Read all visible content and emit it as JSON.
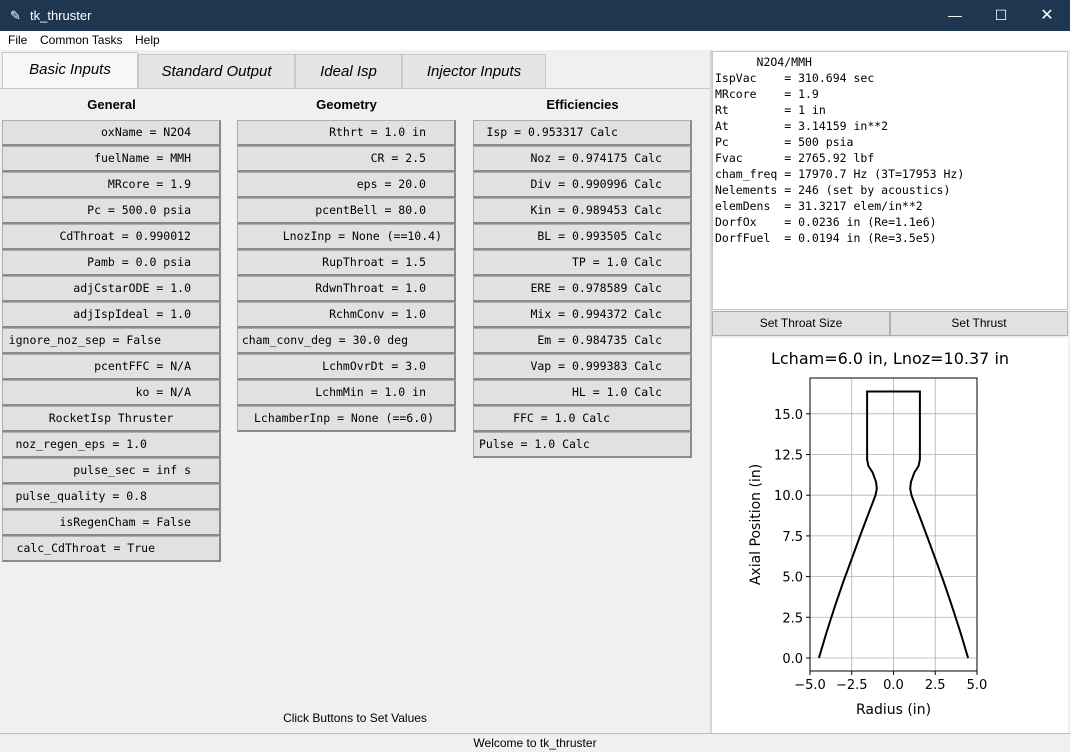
{
  "window": {
    "title": "tk_thruster",
    "min": "—",
    "max": "☐",
    "close": "✕",
    "icon": "feather-icon"
  },
  "menu": [
    "File",
    "Common Tasks",
    "Help"
  ],
  "tabs": [
    "Basic Inputs",
    "Standard Output",
    "Ideal Isp",
    "Injector Inputs"
  ],
  "columns": {
    "general": {
      "title": "General",
      "buttons": [
        "oxName = N2O4",
        "fuelName = MMH",
        "MRcore = 1.9",
        "Pc = 500.0 psia",
        "CdThroat = 0.990012",
        "Pamb = 0.0 psia",
        "adjCstarODE = 1.0",
        "adjIspIdeal = 1.0",
        "ignore_noz_sep = False",
        "pcentFFC = N/A",
        "ko = N/A",
        "RocketIsp Thruster",
        "noz_regen_eps = 1.0",
        "pulse_sec = inf s",
        "pulse_quality = 0.8",
        "isRegenCham = False",
        "calc_CdThroat = True"
      ]
    },
    "geometry": {
      "title": "Geometry",
      "buttons": [
        "Rthrt = 1.0 in",
        "CR = 2.5",
        "eps = 20.0",
        "pcentBell = 80.0",
        "LnozInp = None (==10.4)",
        "RupThroat = 1.5",
        "RdwnThroat = 1.0",
        "RchmConv = 1.0",
        "cham_conv_deg = 30.0 deg",
        "LchmOvrDt = 3.0",
        "LchmMin = 1.0 in",
        "LchamberInp = None (==6.0)"
      ]
    },
    "efficiencies": {
      "title": "Efficiencies",
      "buttons": [
        "Isp = 0.953317 Calc",
        "Noz = 0.974175 Calc",
        "Div = 0.990996 Calc",
        "Kin = 0.989453 Calc",
        "BL = 0.993505 Calc",
        "TP = 1.0 Calc",
        "ERE = 0.978589 Calc",
        "Mix = 0.994372 Calc",
        "Em = 0.984735 Calc",
        "Vap = 0.999383 Calc",
        "HL = 1.0 Calc",
        "FFC = 1.0 Calc",
        "Pulse = 1.0 Calc"
      ]
    }
  },
  "hint": "Click Buttons to Set Values",
  "status": "Welcome to tk_thruster",
  "output_lines": [
    "      N2O4/MMH",
    "IspVac    = 310.694 sec",
    "MRcore    = 1.9",
    "Rt        = 1 in",
    "At        = 3.14159 in**2",
    "Pc        = 500 psia",
    "Fvac      = 2765.92 lbf",
    "cham_freq = 17970.7 Hz (3T=17953 Hz)",
    "Nelements = 246 (set by acoustics)",
    "elemDens  = 31.3217 elem/in**2",
    "DorfOx    = 0.0236 in (Re=1.1e6)",
    "DorfFuel  = 0.0194 in (Re=3.5e5)"
  ],
  "buttons": {
    "throat": "Set Throat Size",
    "thrust": "Set Thrust"
  },
  "chart_data": {
    "type": "line",
    "title": "Lcham=6.0 in, Lnoz=10.37 in",
    "xlabel": "Radius (in)",
    "ylabel": "Axial Position (in)",
    "xlim": [
      -5.0,
      5.0
    ],
    "ylim": [
      -0.8,
      17.2
    ],
    "xticks": [
      "−5.0",
      "−2.5",
      "0.0",
      "2.5",
      "5.0"
    ],
    "yticks": [
      "0.0",
      "2.5",
      "5.0",
      "7.5",
      "10.0",
      "12.5",
      "15.0"
    ],
    "xtick_values": [
      -5.0,
      -2.5,
      0.0,
      2.5,
      5.0
    ],
    "ytick_values": [
      0.0,
      2.5,
      5.0,
      7.5,
      10.0,
      12.5,
      15.0
    ],
    "grid": true,
    "series": [
      {
        "color": "#000000",
        "x": [
          -4.47,
          -4.0,
          -3.5,
          -3.0,
          -2.5,
          -2.0,
          -1.6,
          -1.3,
          -1.08,
          -1.0,
          -1.04,
          -1.25,
          -1.5,
          -1.58,
          -1.58,
          1.58,
          1.58,
          1.5,
          1.25,
          1.04,
          1.0,
          1.08,
          1.3,
          1.6,
          2.0,
          2.5,
          3.0,
          3.5,
          4.0,
          4.47
        ],
        "y": [
          0.0,
          1.6,
          3.2,
          4.7,
          6.1,
          7.5,
          8.6,
          9.4,
          10.0,
          10.4,
          10.8,
          11.4,
          11.8,
          12.2,
          16.37,
          16.37,
          12.2,
          11.8,
          11.4,
          10.8,
          10.4,
          10.0,
          9.4,
          8.6,
          7.5,
          6.1,
          4.7,
          3.2,
          1.6,
          0.0
        ]
      }
    ]
  }
}
